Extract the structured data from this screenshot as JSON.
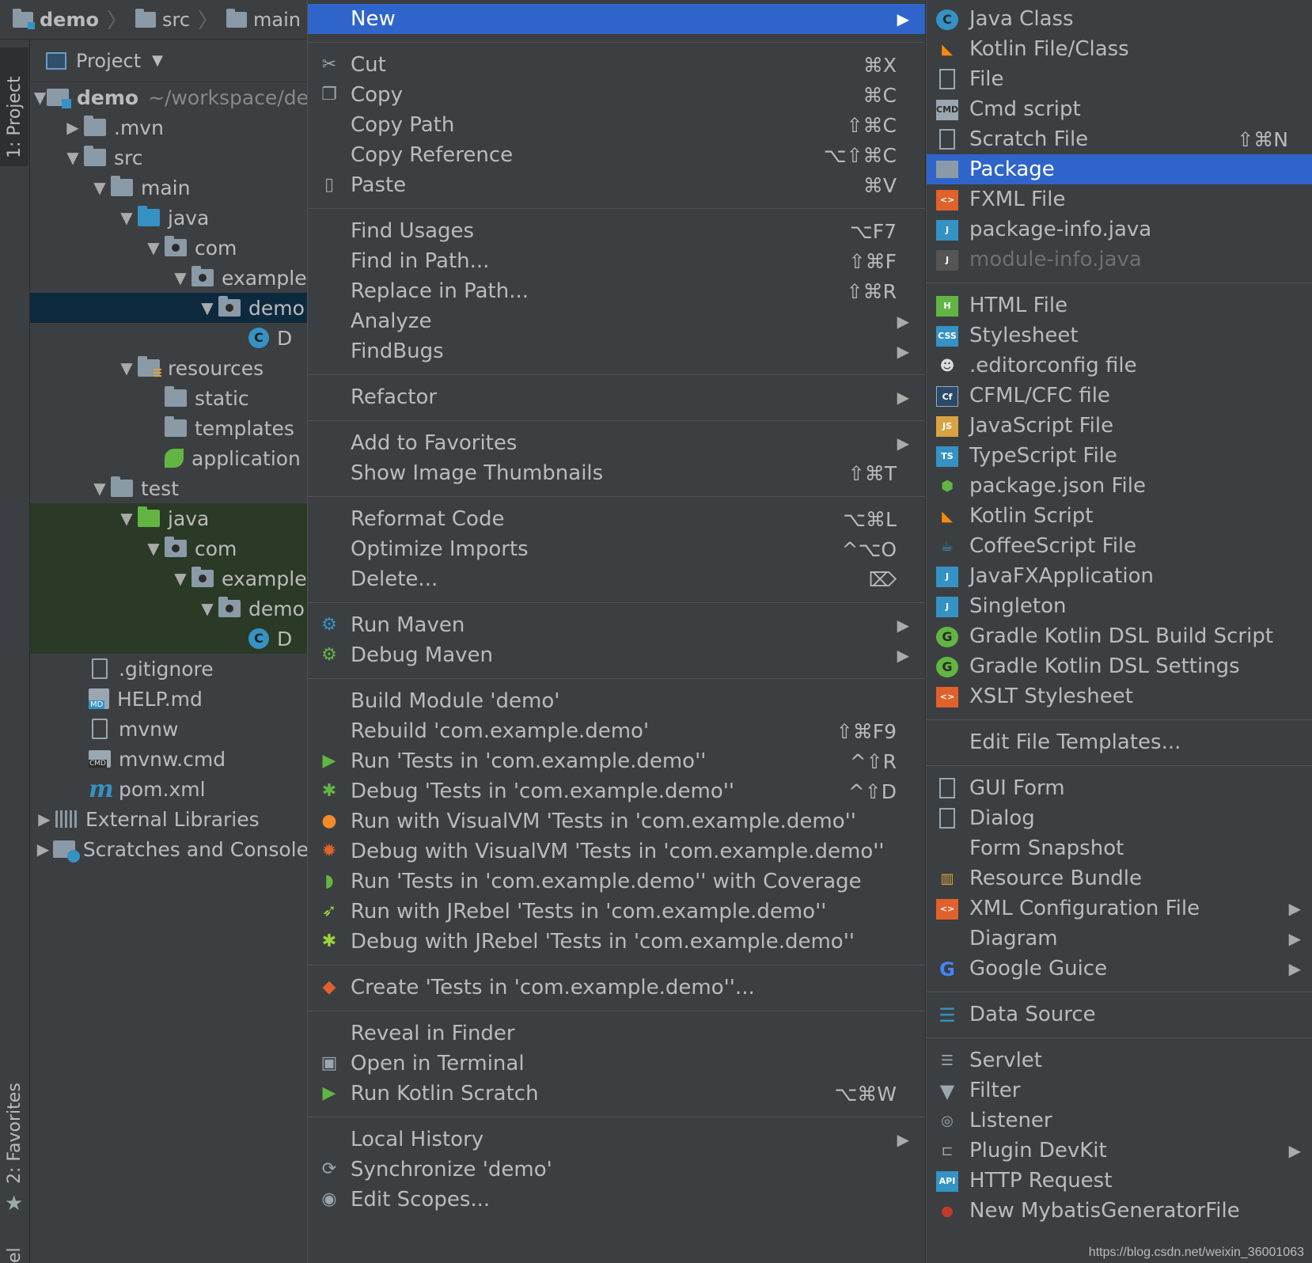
{
  "breadcrumb": {
    "items": [
      "demo",
      "src",
      "main"
    ]
  },
  "stripe": {
    "project_tab": "1: Project",
    "favorites_tab": "2: Favorites",
    "bottom_tab": "el"
  },
  "panel": {
    "title": "Project",
    "tree": [
      {
        "label": "demo",
        "sub": "~/workspace/de"
      },
      {
        "label": ".mvn"
      },
      {
        "label": "src"
      },
      {
        "label": "main"
      },
      {
        "label": "java"
      },
      {
        "label": "com"
      },
      {
        "label": "example"
      },
      {
        "label": "demo"
      },
      {
        "label": "D"
      },
      {
        "label": "resources"
      },
      {
        "label": "static"
      },
      {
        "label": "templates"
      },
      {
        "label": "application"
      },
      {
        "label": "test"
      },
      {
        "label": "java"
      },
      {
        "label": "com"
      },
      {
        "label": "example"
      },
      {
        "label": "demo"
      },
      {
        "label": "D"
      },
      {
        "label": ".gitignore"
      },
      {
        "label": "HELP.md"
      },
      {
        "label": "mvnw"
      },
      {
        "label": "mvnw.cmd"
      },
      {
        "label": "pom.xml"
      },
      {
        "label": "External Libraries"
      },
      {
        "label": "Scratches and Console"
      }
    ]
  },
  "menu": {
    "new": {
      "label": "New"
    },
    "cut": {
      "label": "Cut",
      "shortcut": "⌘X"
    },
    "copy": {
      "label": "Copy",
      "shortcut": "⌘C"
    },
    "copy_path": {
      "label": "Copy Path",
      "shortcut": "⇧⌘C"
    },
    "copy_reference": {
      "label": "Copy Reference",
      "shortcut": "⌥⇧⌘C"
    },
    "paste": {
      "label": "Paste",
      "shortcut": "⌘V"
    },
    "find_usages": {
      "label": "Find Usages",
      "shortcut": "⌥F7"
    },
    "find_in_path": {
      "label": "Find in Path...",
      "shortcut": "⇧⌘F"
    },
    "replace_in_path": {
      "label": "Replace in Path...",
      "shortcut": "⇧⌘R"
    },
    "analyze": {
      "label": "Analyze"
    },
    "findbugs": {
      "label": "FindBugs"
    },
    "refactor": {
      "label": "Refactor"
    },
    "add_to_favorites": {
      "label": "Add to Favorites"
    },
    "show_image_thumbnails": {
      "label": "Show Image Thumbnails",
      "shortcut": "⇧⌘T"
    },
    "reformat_code": {
      "label": "Reformat Code",
      "shortcut": "⌥⌘L"
    },
    "optimize_imports": {
      "label": "Optimize Imports",
      "shortcut": "^⌥O"
    },
    "delete": {
      "label": "Delete...",
      "shortcut": "⌦"
    },
    "run_maven": {
      "label": "Run Maven"
    },
    "debug_maven": {
      "label": "Debug Maven"
    },
    "build_module": {
      "label": "Build Module 'demo'"
    },
    "rebuild": {
      "label": "Rebuild 'com.example.demo'",
      "shortcut": "⇧⌘F9"
    },
    "run_tests": {
      "label": "Run 'Tests in 'com.example.demo''",
      "shortcut": "^⇧R"
    },
    "debug_tests": {
      "label": "Debug 'Tests in 'com.example.demo''",
      "shortcut": "^⇧D"
    },
    "run_visualvm": {
      "label": "Run with VisualVM 'Tests in 'com.example.demo''"
    },
    "debug_visualvm": {
      "label": "Debug with VisualVM 'Tests in 'com.example.demo''"
    },
    "run_coverage": {
      "label": "Run 'Tests in 'com.example.demo'' with Coverage"
    },
    "run_jrebel": {
      "label": "Run with JRebel 'Tests in 'com.example.demo''"
    },
    "debug_jrebel": {
      "label": "Debug with JRebel 'Tests in 'com.example.demo''"
    },
    "create_tests": {
      "label": "Create 'Tests in 'com.example.demo''..."
    },
    "reveal_in_finder": {
      "label": "Reveal in Finder"
    },
    "open_in_terminal": {
      "label": "Open in Terminal"
    },
    "run_kotlin_scratch": {
      "label": "Run Kotlin Scratch",
      "shortcut": "⌥⌘W"
    },
    "local_history": {
      "label": "Local History"
    },
    "synchronize": {
      "label": "Synchronize 'demo'"
    },
    "edit_scopes": {
      "label": "Edit Scopes..."
    }
  },
  "submenu": {
    "java_class": "Java Class",
    "kotlin_file": "Kotlin File/Class",
    "file": "File",
    "cmd_script": "Cmd script",
    "scratch_file": {
      "label": "Scratch File",
      "shortcut": "⇧⌘N"
    },
    "package": "Package",
    "fxml_file": "FXML File",
    "package_info": "package-info.java",
    "module_info": "module-info.java",
    "html_file": "HTML File",
    "stylesheet": "Stylesheet",
    "editorconfig": ".editorconfig file",
    "cfml": "CFML/CFC file",
    "javascript": "JavaScript File",
    "typescript": "TypeScript File",
    "package_json": "package.json File",
    "kotlin_script": "Kotlin Script",
    "coffeescript": "CoffeeScript File",
    "javafx": "JavaFXApplication",
    "singleton": "Singleton",
    "gradle_build": "Gradle Kotlin DSL Build Script",
    "gradle_settings": "Gradle Kotlin DSL Settings",
    "xslt": "XSLT Stylesheet",
    "edit_templates": "Edit File Templates...",
    "gui_form": "GUI Form",
    "dialog": "Dialog",
    "form_snapshot": "Form Snapshot",
    "resource_bundle": "Resource Bundle",
    "xml_config": "XML Configuration File",
    "diagram": "Diagram",
    "google_guice": "Google Guice",
    "data_source": "Data Source",
    "servlet": "Servlet",
    "filter": "Filter",
    "listener": "Listener",
    "plugin_devkit": "Plugin DevKit",
    "http_request": "HTTP Request",
    "mybatis": "New MybatisGeneratorFile"
  },
  "watermark": "https://blog.csdn.net/weixin_36001063",
  "colors": {
    "highlight": "#2f65ca",
    "menu_bg": "#3c3f41",
    "editor_bg": "#2b2b2b",
    "text": "#bbbbbb",
    "selection_tree": "#0d293e",
    "test_tree": "#2a3a26"
  }
}
